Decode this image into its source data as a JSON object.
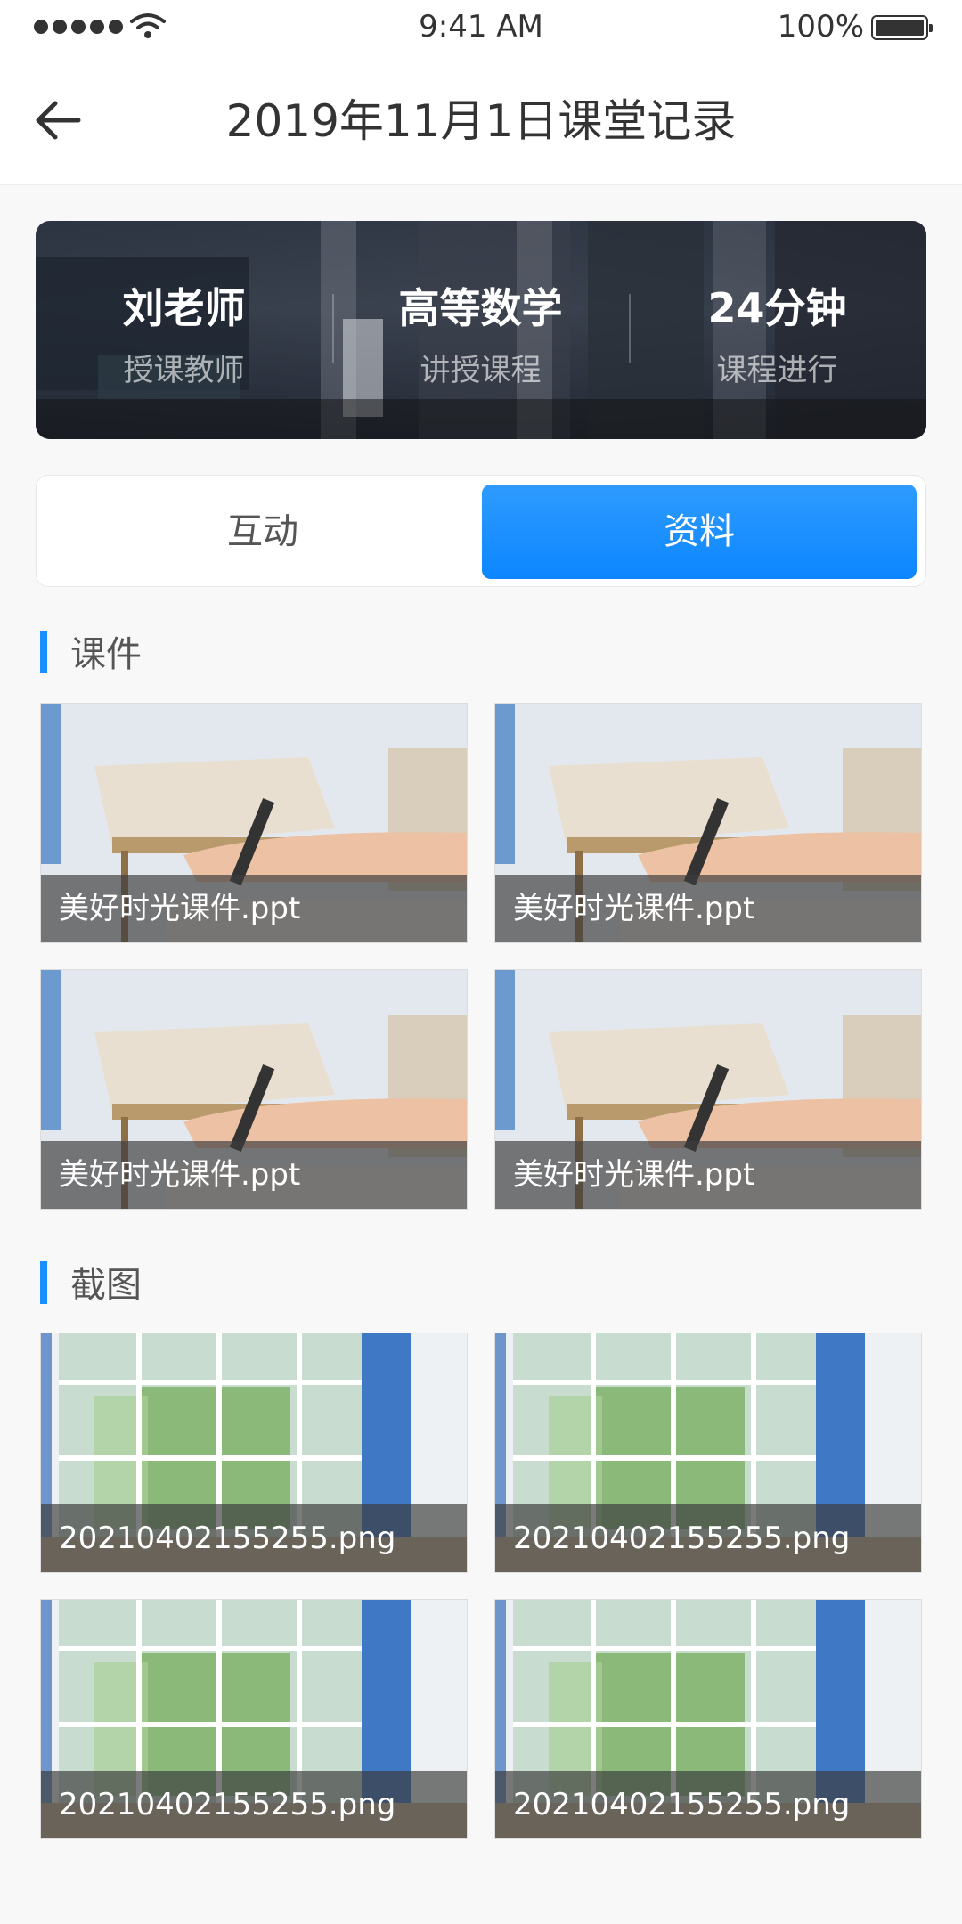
{
  "status_bar": {
    "time": "9:41 AM",
    "battery": "100%"
  },
  "header": {
    "title": "2019年11月1日课堂记录"
  },
  "info": [
    {
      "value": "刘老师",
      "label": "授课教师"
    },
    {
      "value": "高等数学",
      "label": "讲授课程"
    },
    {
      "value": "24分钟",
      "label": "课程进行"
    }
  ],
  "tabs": [
    {
      "label": "互动",
      "active": false
    },
    {
      "label": "资料",
      "active": true
    }
  ],
  "sections": [
    {
      "title": "课件",
      "items": [
        "美好时光课件.ppt",
        "美好时光课件.ppt",
        "美好时光课件.ppt",
        "美好时光课件.ppt"
      ]
    },
    {
      "title": "截图",
      "items": [
        "20210402155255.png",
        "20210402155255.png",
        "20210402155255.png",
        "20210402155255.png"
      ]
    }
  ],
  "colors": {
    "accent": "#1c8fff",
    "tab_active": "#0c86ff"
  }
}
